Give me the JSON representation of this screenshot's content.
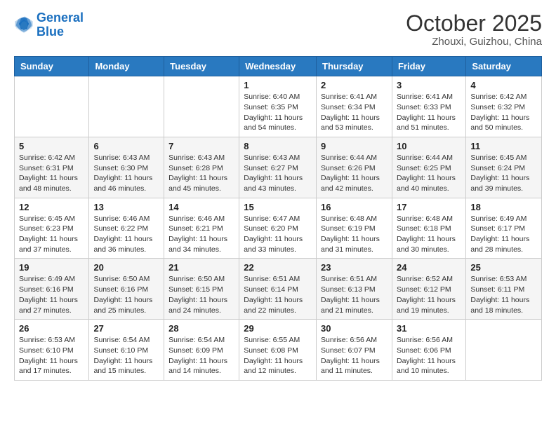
{
  "logo": {
    "line1": "General",
    "line2": "Blue"
  },
  "title": "October 2025",
  "subtitle": "Zhouxi, Guizhou, China",
  "days": [
    "Sunday",
    "Monday",
    "Tuesday",
    "Wednesday",
    "Thursday",
    "Friday",
    "Saturday"
  ],
  "weeks": [
    [
      {
        "num": "",
        "sunrise": "",
        "sunset": "",
        "daylight": ""
      },
      {
        "num": "",
        "sunrise": "",
        "sunset": "",
        "daylight": ""
      },
      {
        "num": "",
        "sunrise": "",
        "sunset": "",
        "daylight": ""
      },
      {
        "num": "1",
        "sunrise": "Sunrise: 6:40 AM",
        "sunset": "Sunset: 6:35 PM",
        "daylight": "Daylight: 11 hours and 54 minutes."
      },
      {
        "num": "2",
        "sunrise": "Sunrise: 6:41 AM",
        "sunset": "Sunset: 6:34 PM",
        "daylight": "Daylight: 11 hours and 53 minutes."
      },
      {
        "num": "3",
        "sunrise": "Sunrise: 6:41 AM",
        "sunset": "Sunset: 6:33 PM",
        "daylight": "Daylight: 11 hours and 51 minutes."
      },
      {
        "num": "4",
        "sunrise": "Sunrise: 6:42 AM",
        "sunset": "Sunset: 6:32 PM",
        "daylight": "Daylight: 11 hours and 50 minutes."
      }
    ],
    [
      {
        "num": "5",
        "sunrise": "Sunrise: 6:42 AM",
        "sunset": "Sunset: 6:31 PM",
        "daylight": "Daylight: 11 hours and 48 minutes."
      },
      {
        "num": "6",
        "sunrise": "Sunrise: 6:43 AM",
        "sunset": "Sunset: 6:30 PM",
        "daylight": "Daylight: 11 hours and 46 minutes."
      },
      {
        "num": "7",
        "sunrise": "Sunrise: 6:43 AM",
        "sunset": "Sunset: 6:28 PM",
        "daylight": "Daylight: 11 hours and 45 minutes."
      },
      {
        "num": "8",
        "sunrise": "Sunrise: 6:43 AM",
        "sunset": "Sunset: 6:27 PM",
        "daylight": "Daylight: 11 hours and 43 minutes."
      },
      {
        "num": "9",
        "sunrise": "Sunrise: 6:44 AM",
        "sunset": "Sunset: 6:26 PM",
        "daylight": "Daylight: 11 hours and 42 minutes."
      },
      {
        "num": "10",
        "sunrise": "Sunrise: 6:44 AM",
        "sunset": "Sunset: 6:25 PM",
        "daylight": "Daylight: 11 hours and 40 minutes."
      },
      {
        "num": "11",
        "sunrise": "Sunrise: 6:45 AM",
        "sunset": "Sunset: 6:24 PM",
        "daylight": "Daylight: 11 hours and 39 minutes."
      }
    ],
    [
      {
        "num": "12",
        "sunrise": "Sunrise: 6:45 AM",
        "sunset": "Sunset: 6:23 PM",
        "daylight": "Daylight: 11 hours and 37 minutes."
      },
      {
        "num": "13",
        "sunrise": "Sunrise: 6:46 AM",
        "sunset": "Sunset: 6:22 PM",
        "daylight": "Daylight: 11 hours and 36 minutes."
      },
      {
        "num": "14",
        "sunrise": "Sunrise: 6:46 AM",
        "sunset": "Sunset: 6:21 PM",
        "daylight": "Daylight: 11 hours and 34 minutes."
      },
      {
        "num": "15",
        "sunrise": "Sunrise: 6:47 AM",
        "sunset": "Sunset: 6:20 PM",
        "daylight": "Daylight: 11 hours and 33 minutes."
      },
      {
        "num": "16",
        "sunrise": "Sunrise: 6:48 AM",
        "sunset": "Sunset: 6:19 PM",
        "daylight": "Daylight: 11 hours and 31 minutes."
      },
      {
        "num": "17",
        "sunrise": "Sunrise: 6:48 AM",
        "sunset": "Sunset: 6:18 PM",
        "daylight": "Daylight: 11 hours and 30 minutes."
      },
      {
        "num": "18",
        "sunrise": "Sunrise: 6:49 AM",
        "sunset": "Sunset: 6:17 PM",
        "daylight": "Daylight: 11 hours and 28 minutes."
      }
    ],
    [
      {
        "num": "19",
        "sunrise": "Sunrise: 6:49 AM",
        "sunset": "Sunset: 6:16 PM",
        "daylight": "Daylight: 11 hours and 27 minutes."
      },
      {
        "num": "20",
        "sunrise": "Sunrise: 6:50 AM",
        "sunset": "Sunset: 6:16 PM",
        "daylight": "Daylight: 11 hours and 25 minutes."
      },
      {
        "num": "21",
        "sunrise": "Sunrise: 6:50 AM",
        "sunset": "Sunset: 6:15 PM",
        "daylight": "Daylight: 11 hours and 24 minutes."
      },
      {
        "num": "22",
        "sunrise": "Sunrise: 6:51 AM",
        "sunset": "Sunset: 6:14 PM",
        "daylight": "Daylight: 11 hours and 22 minutes."
      },
      {
        "num": "23",
        "sunrise": "Sunrise: 6:51 AM",
        "sunset": "Sunset: 6:13 PM",
        "daylight": "Daylight: 11 hours and 21 minutes."
      },
      {
        "num": "24",
        "sunrise": "Sunrise: 6:52 AM",
        "sunset": "Sunset: 6:12 PM",
        "daylight": "Daylight: 11 hours and 19 minutes."
      },
      {
        "num": "25",
        "sunrise": "Sunrise: 6:53 AM",
        "sunset": "Sunset: 6:11 PM",
        "daylight": "Daylight: 11 hours and 18 minutes."
      }
    ],
    [
      {
        "num": "26",
        "sunrise": "Sunrise: 6:53 AM",
        "sunset": "Sunset: 6:10 PM",
        "daylight": "Daylight: 11 hours and 17 minutes."
      },
      {
        "num": "27",
        "sunrise": "Sunrise: 6:54 AM",
        "sunset": "Sunset: 6:10 PM",
        "daylight": "Daylight: 11 hours and 15 minutes."
      },
      {
        "num": "28",
        "sunrise": "Sunrise: 6:54 AM",
        "sunset": "Sunset: 6:09 PM",
        "daylight": "Daylight: 11 hours and 14 minutes."
      },
      {
        "num": "29",
        "sunrise": "Sunrise: 6:55 AM",
        "sunset": "Sunset: 6:08 PM",
        "daylight": "Daylight: 11 hours and 12 minutes."
      },
      {
        "num": "30",
        "sunrise": "Sunrise: 6:56 AM",
        "sunset": "Sunset: 6:07 PM",
        "daylight": "Daylight: 11 hours and 11 minutes."
      },
      {
        "num": "31",
        "sunrise": "Sunrise: 6:56 AM",
        "sunset": "Sunset: 6:06 PM",
        "daylight": "Daylight: 11 hours and 10 minutes."
      },
      {
        "num": "",
        "sunrise": "",
        "sunset": "",
        "daylight": ""
      }
    ]
  ]
}
